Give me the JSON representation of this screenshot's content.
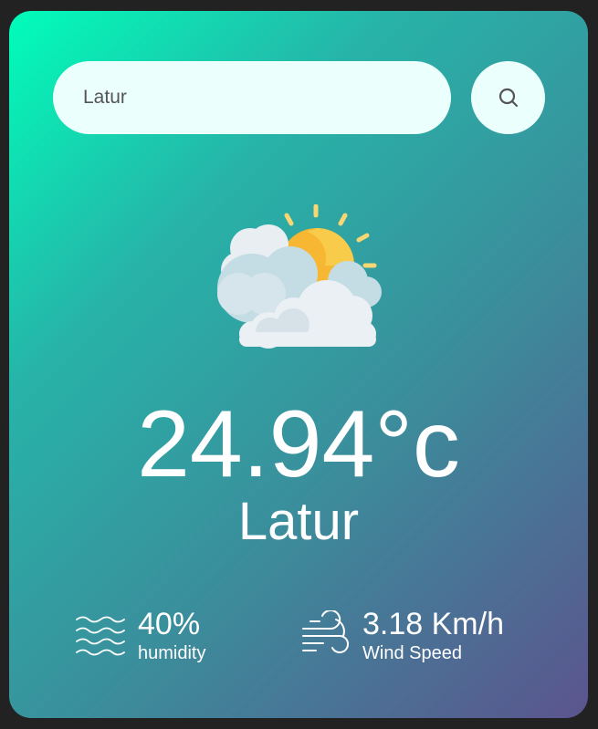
{
  "search": {
    "value": "Latur",
    "button_icon": "search-icon"
  },
  "weather": {
    "icon": "partly-cloudy-icon",
    "temperature": "24.94°c",
    "city": "Latur"
  },
  "details": {
    "humidity": {
      "icon": "humidity-icon",
      "value": "40%",
      "label": "humidity"
    },
    "wind": {
      "icon": "wind-icon",
      "value": "3.18 Km/h",
      "label": "Wind Speed"
    }
  },
  "colors": {
    "gradient_start": "#00feba",
    "gradient_end": "#5b548e",
    "input_bg": "#ebfffc",
    "text": "#ffffff"
  }
}
